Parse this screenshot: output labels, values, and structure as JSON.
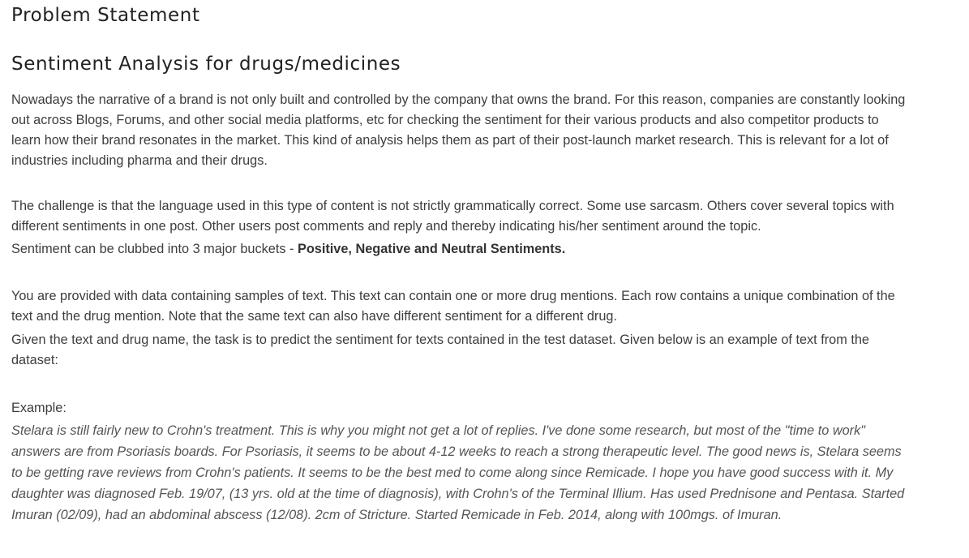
{
  "page_title": "Problem Statement",
  "section_title": "Sentiment Analysis for drugs/medicines",
  "paragraph_1": "Nowadays the narrative of a brand is not only built and controlled by the company that owns the brand. For this reason, companies are constantly looking out across Blogs, Forums, and other social media platforms, etc for checking the sentiment for their various products and also competitor products to learn how their brand resonates in the market. This kind of analysis helps them as part of their post-launch market research. This is relevant for a lot of industries including pharma and their drugs.",
  "paragraph_2": {
    "intro": "The challenge is that the language used in this type of content is not strictly grammatically correct. Some use sarcasm. Others cover several topics with different sentiments in one post. Other users post comments and reply and thereby indicating his/her sentiment around the topic.",
    "buckets_prefix": "Sentiment can be clubbed into 3 major buckets - ",
    "buckets_bold": "Positive, Negative and Neutral Sentiments."
  },
  "paragraph_3": "You are provided with data containing samples of text. This text can contain one or more drug mentions. Each row contains a unique combination of the text and the drug mention. Note that the same text can also have different sentiment for a different drug.",
  "paragraph_4": "Given the text and drug name, the task is to predict the sentiment for texts contained in the test dataset. Given below is an example of text from the dataset:",
  "example_label": "Example:",
  "example_text": "Stelara is still fairly new to Crohn's treatment. This is why you might not get a lot of replies. I've done some research, but most of the \"time to work\" answers are from Psoriasis boards. For Psoriasis, it seems to be about 4-12 weeks to reach a strong therapeutic level. The good news is, Stelara seems to be getting rave reviews from Crohn's patients. It seems to be the best med to come along since Remicade. I hope you have good success with it. My daughter was diagnosed Feb. 19/07, (13 yrs. old at the time of diagnosis), with Crohn's of the Terminal Illium. Has used Prednisone and Pentasa. Started Imuran (02/09), had an abdominal abscess (12/08). 2cm of Stricture. Started Remicade in Feb. 2014, along with 100mgs. of Imuran."
}
